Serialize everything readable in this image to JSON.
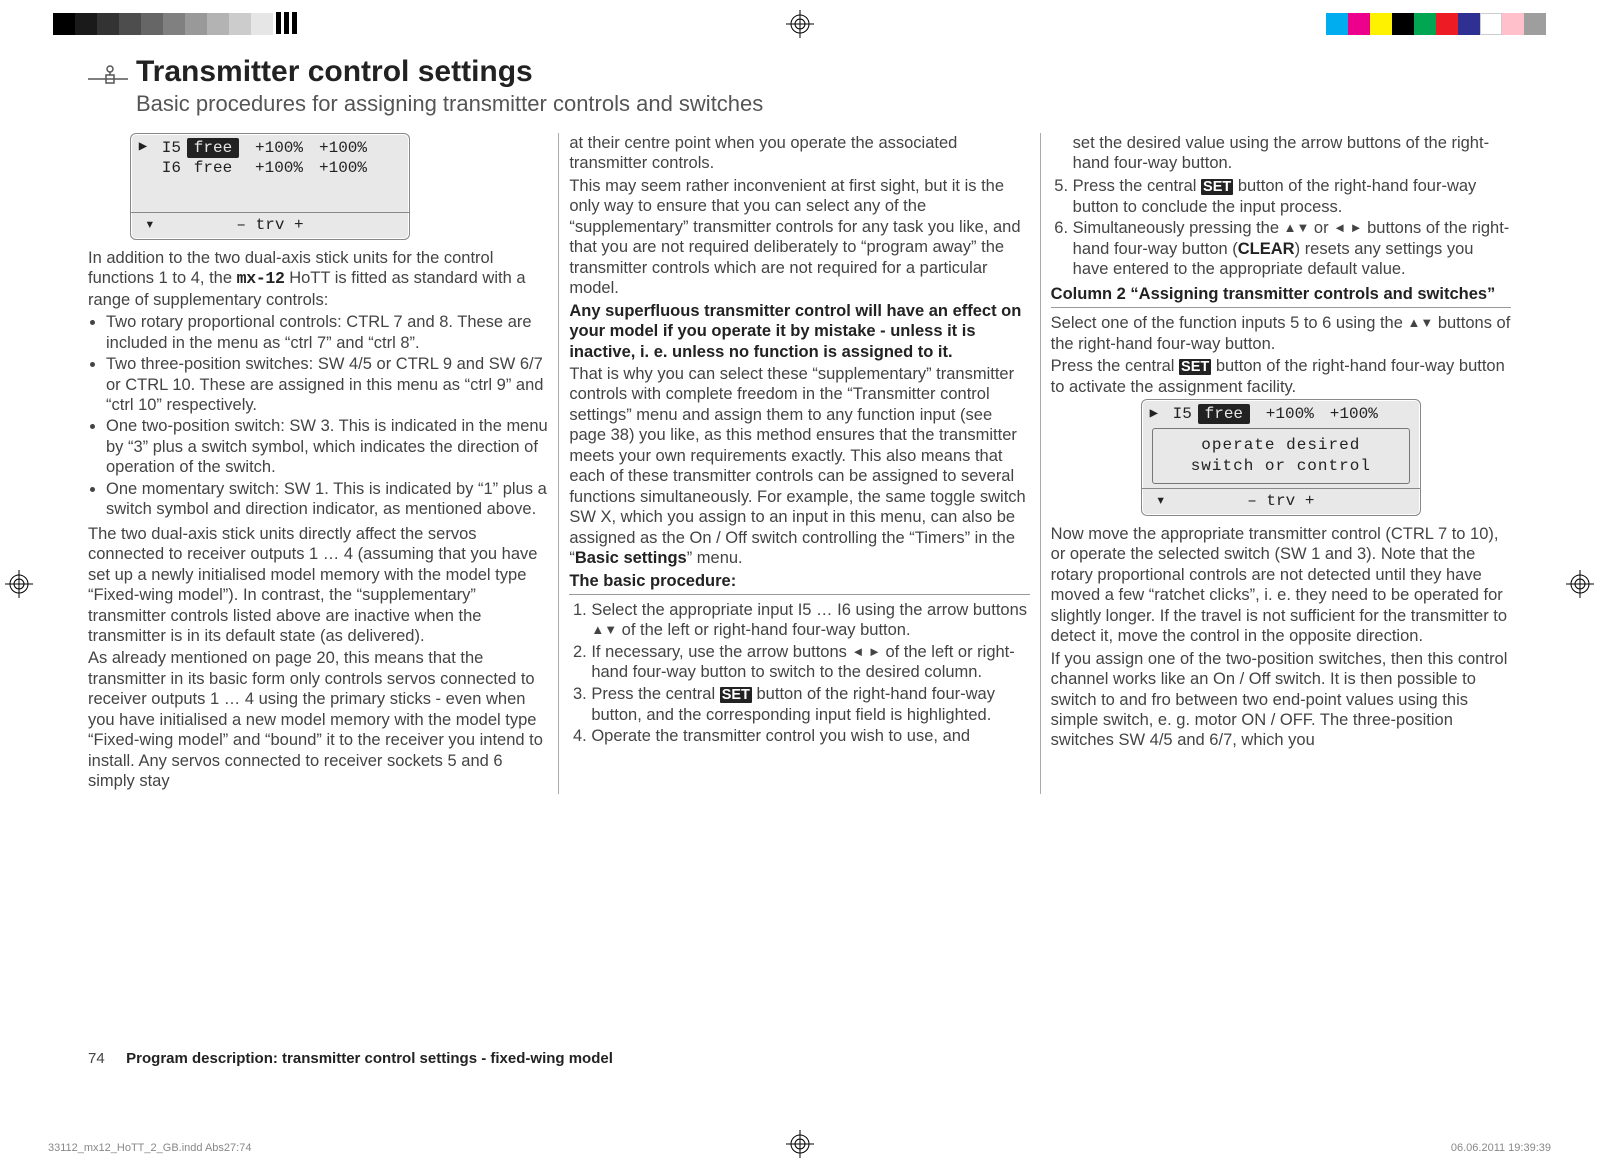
{
  "printer": {
    "bars_left": [
      "#000",
      "#1a1a1a",
      "#333",
      "#4d4d4d",
      "#666",
      "#808080",
      "#999",
      "#b3b3b3",
      "#ccc",
      "#e6e6e6"
    ],
    "bars_right": [
      "#00aeef",
      "#ec008c",
      "#fff200",
      "#000000",
      "#00a651",
      "#ed1c24",
      "#2e3192",
      "#fff",
      "#ffc0cb",
      "#9e9e9e"
    ],
    "slug_left": "33112_mx12_HoTT_2_GB.indd   Abs27:74",
    "slug_right": "06.06.2011   19:39:39"
  },
  "title": "Transmitter control settings",
  "subtitle": "Basic procedures for assigning transmitter controls and switches",
  "lcd1": {
    "rows": [
      {
        "arrow": "▶",
        "label": "I5",
        "val1": "free",
        "hl": true,
        "val2": "+100%",
        "val3": "+100%"
      },
      {
        "arrow": "",
        "label": "I6",
        "val1": "free",
        "hl": false,
        "val2": "+100%",
        "val3": "+100%"
      }
    ],
    "footer_left": "▾",
    "footer_mid": "–   trv   +"
  },
  "col1": {
    "p1a": "In addition to the two dual-axis stick units for the control functions 1 to 4, the ",
    "mx12": "mx-12",
    "p1b": " HoTT is fitted as standard with a range of supplementary controls:",
    "bullets": [
      "Two rotary proportional controls: CTRL 7 and 8. These are included in the menu as “ctrl 7” and “ctrl 8”.",
      "Two three-position switches: SW 4/5 or CTRL 9 and SW 6/7 or CTRL 10. These are assigned in this menu as “ctrl 9” and “ctrl 10” respectively.",
      "One two-position switch: SW 3. This is indicated in the menu by “3” plus a switch symbol, which indicates the direction of operation of the switch.",
      "One momentary switch: SW 1. This is indicated by “1” plus a switch symbol and direction indicator, as mentioned above."
    ],
    "p2": "The two dual-axis stick units directly affect the servos connected to receiver outputs 1 … 4 (assuming that you have set up a newly initialised model memory with the model type “Fixed-wing model”). In contrast, the “supplementary” transmitter controls listed above are inactive when the transmitter is in its default state (as delivered).",
    "p3": "As already mentioned on page 20, this means that the transmitter in its basic form only controls servos connected to receiver outputs 1 … 4 using the primary sticks - even when you have initialised a new model memory with the model type “Fixed-wing model” and “bound” it to the receiver you intend to install. Any servos connected to receiver sockets 5 and 6 simply stay"
  },
  "col2": {
    "p0": "at their centre point when you operate the associated transmitter controls.",
    "p1": "This may seem rather inconvenient at first sight, but it is the only way to ensure that you can select any of the “supplementary” transmitter controls for any task you like, and that you are not required deliberately to “program away” the transmitter controls which are not required for a particular model.",
    "strong1": "Any superfluous transmitter control will have an effect on your model if you operate it by mistake - unless it is inactive, i. e. unless no function is assigned to it.",
    "p2a": "That is why you can select these “supplementary” transmitter controls with complete freedom in the “Transmitter control settings” menu and assign them to any function input (see page 38) you like, as this method ensures that the transmitter meets your own requirements exactly. This also means that each of these transmitter controls can be assigned to several functions simultaneously. For example, the same toggle switch SW X, which you assign to an input in this menu, can also be assigned as the On / Off switch controlling the “Timers” in the “",
    "p2b_bold": "Basic settings",
    "p2c": "” menu.",
    "basic_heading": "The basic procedure:",
    "steps": {
      "s1a": "Select the appropriate input I5 … I6 using the arrow buttons ",
      "s1b": " of the left or right-hand four-way button.",
      "s2a": "If necessary, use the arrow buttons ",
      "s2b": " of the left or right-hand four-way button to switch to the desired column.",
      "s3a": "Press the central ",
      "s3b": " button of the right-hand four-way button, and the corresponding input field is highlighted.",
      "s4": "Operate the transmitter control you wish to use, and"
    },
    "set": "SET"
  },
  "col3": {
    "p0": "set the desired value using the arrow buttons of the right-hand four-way button.",
    "s5a": "Press the central ",
    "s5b": " button of the right-hand four-way button to conclude the input process.",
    "s6a": "Simultaneously pressing the ",
    "s6b": " or ",
    "s6c": " buttons of the right-hand four-way button (",
    "clear": "CLEAR",
    "s6d": ") resets any settings you have entered to the appropriate default value.",
    "heading": "Column 2 “Assigning transmitter controls and switches”",
    "p1a": "Select one of the function inputs 5 to 6 using the ",
    "p1b": " buttons of the right-hand four-way button.",
    "p2a": "Press the central ",
    "p2b": " button of the right-hand four-way button to activate the assignment facility.",
    "set": "SET",
    "lcd2": {
      "row": {
        "arrow": "▶",
        "label": "I5",
        "val1": "free",
        "val2": "+100%",
        "val3": "+100%"
      },
      "msg1": "operate desired",
      "msg2": "switch  or  control",
      "footer_left": "▾",
      "footer_mid": "–   trv   +"
    },
    "p3": "Now move the appropriate transmitter control (CTRL 7 to 10), or operate the selected switch (SW 1 and 3). Note that the rotary proportional controls are not detected until they have moved a few “ratchet clicks”, i. e. they need to be operated for slightly longer. If the travel is not sufficient for the transmitter to detect it, move the control in the opposite direction.",
    "p4": "If you assign one of the two-position switches, then this control channel works like an On / Off switch. It is then possible to switch to and fro between two end-point values using this simple switch, e. g. motor ON / OFF. The three-position switches SW 4/5 and 6/7, which you"
  },
  "footer": {
    "page": "74",
    "text": "Program description: transmitter control settings - fixed-wing model"
  }
}
